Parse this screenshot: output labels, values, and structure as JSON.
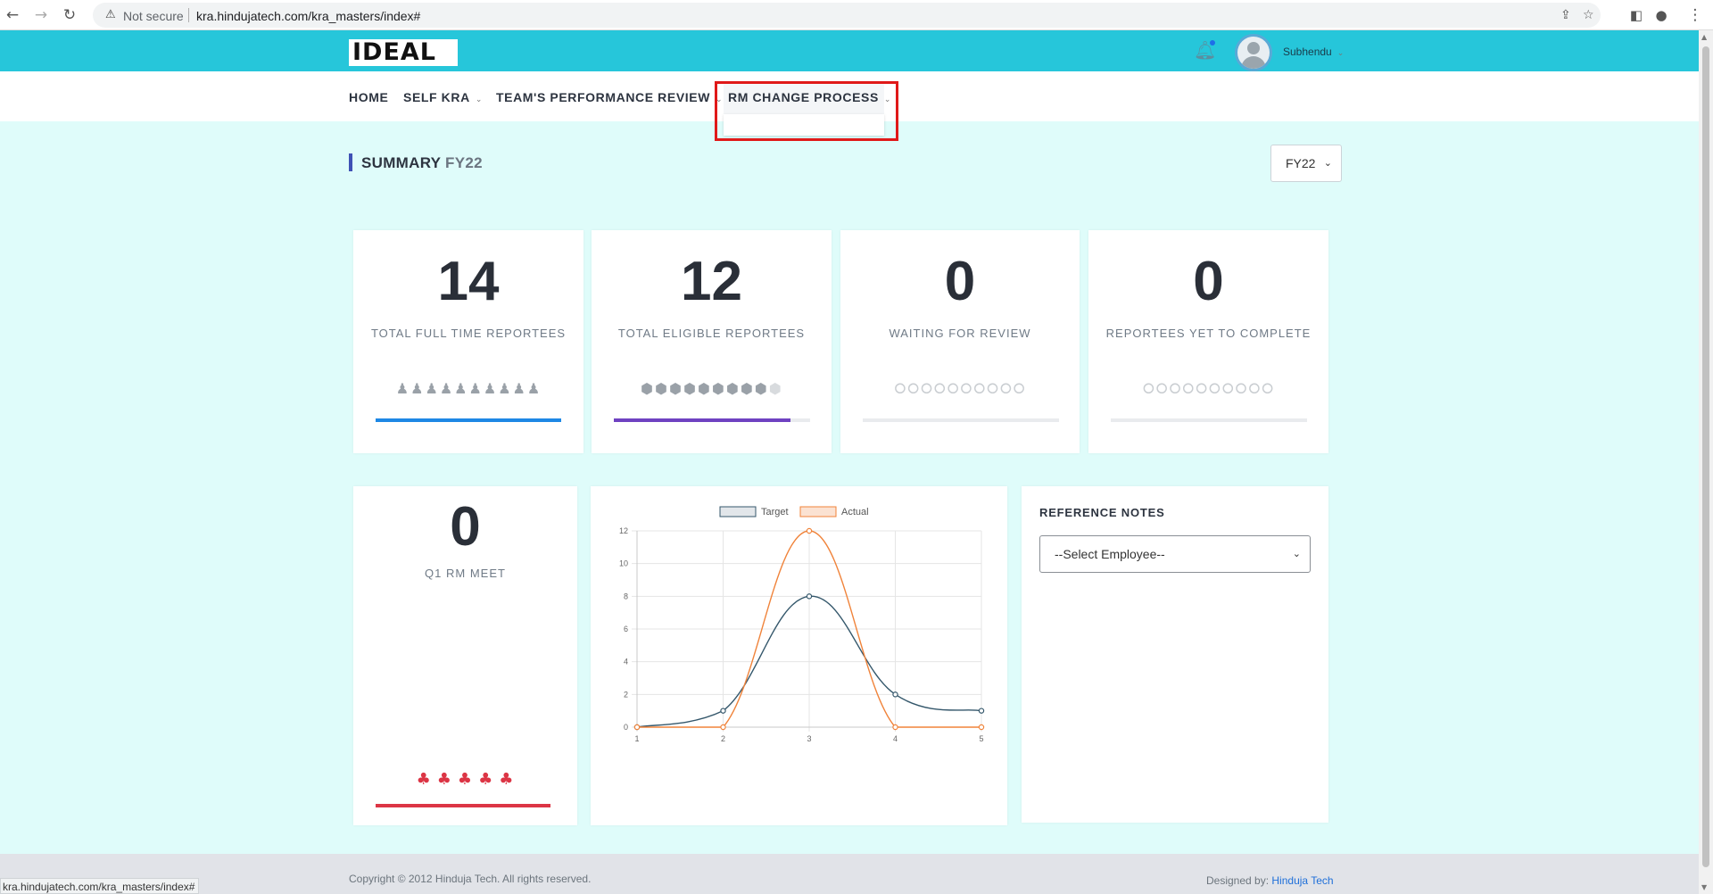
{
  "browser": {
    "security_label": "Not secure",
    "url": "kra.hindujatech.com/kra_masters/index#",
    "status_url": "kra.hindujatech.com/kra_masters/index#"
  },
  "header": {
    "logo_text": "IDEAL",
    "user_name": "Subhendu"
  },
  "nav": {
    "home": "HOME",
    "self_kra": "SELF KRA",
    "team_review": "TEAM'S PERFORMANCE REVIEW",
    "rm_change": "RM CHANGE PROCESS"
  },
  "summary": {
    "title": "SUMMARY",
    "fy": "FY22",
    "fy_select_value": "FY22"
  },
  "stats": [
    {
      "value": "14",
      "label": "TOTAL FULL TIME REPORTEES",
      "icon": "person-icon",
      "icon_count": 10,
      "icon_color": "#9aa1a8",
      "bar_color": "#1e88e5",
      "progress": 1.0
    },
    {
      "value": "12",
      "label": "TOTAL ELIGIBLE REPORTEES",
      "icon": "cube-icon",
      "icon_count": 10,
      "icon_color": "#9aa1a8",
      "bar_color": "#6f42c1",
      "progress": 0.9
    },
    {
      "value": "0",
      "label": "WAITING FOR REVIEW",
      "icon": "pin-icon",
      "icon_count": 10,
      "icon_color": "#c9cdd1",
      "bar_color": "#9aa1a8",
      "progress": 0
    },
    {
      "value": "0",
      "label": "REPORTEES YET TO COMPLETE",
      "icon": "pin-icon",
      "icon_count": 10,
      "icon_color": "#c9cdd1",
      "bar_color": "#9aa1a8",
      "progress": 0
    }
  ],
  "rm_meet": {
    "value": "0",
    "label": "Q1 RM MEET",
    "icon": "group-icon",
    "icon_count": 5,
    "icon_color": "#dc3545",
    "bar_color": "#dc3545",
    "progress": 1.0
  },
  "chart_data": {
    "type": "line",
    "x": [
      1,
      2,
      3,
      4,
      5
    ],
    "series": [
      {
        "name": "Target",
        "values": [
          0,
          1,
          8,
          2,
          1
        ],
        "color": "#34576b"
      },
      {
        "name": "Actual",
        "values": [
          0,
          0,
          12,
          0,
          0
        ],
        "color": "#f0833a"
      }
    ],
    "ylim": [
      0,
      12
    ],
    "yticks": [
      "0",
      "2",
      "4",
      "6",
      "8",
      "10",
      "12"
    ],
    "xticks": [
      "1",
      "2",
      "3",
      "4",
      "5"
    ],
    "legend": "top-center",
    "grid": true
  },
  "reference": {
    "title": "REFERENCE NOTES",
    "select_value": "--Select Employee--"
  },
  "footer": {
    "copyright": "Copyright © 2012 Hinduja Tech. All rights reserved.",
    "designed_by": "Designed by:",
    "designer": "Hinduja Tech"
  }
}
